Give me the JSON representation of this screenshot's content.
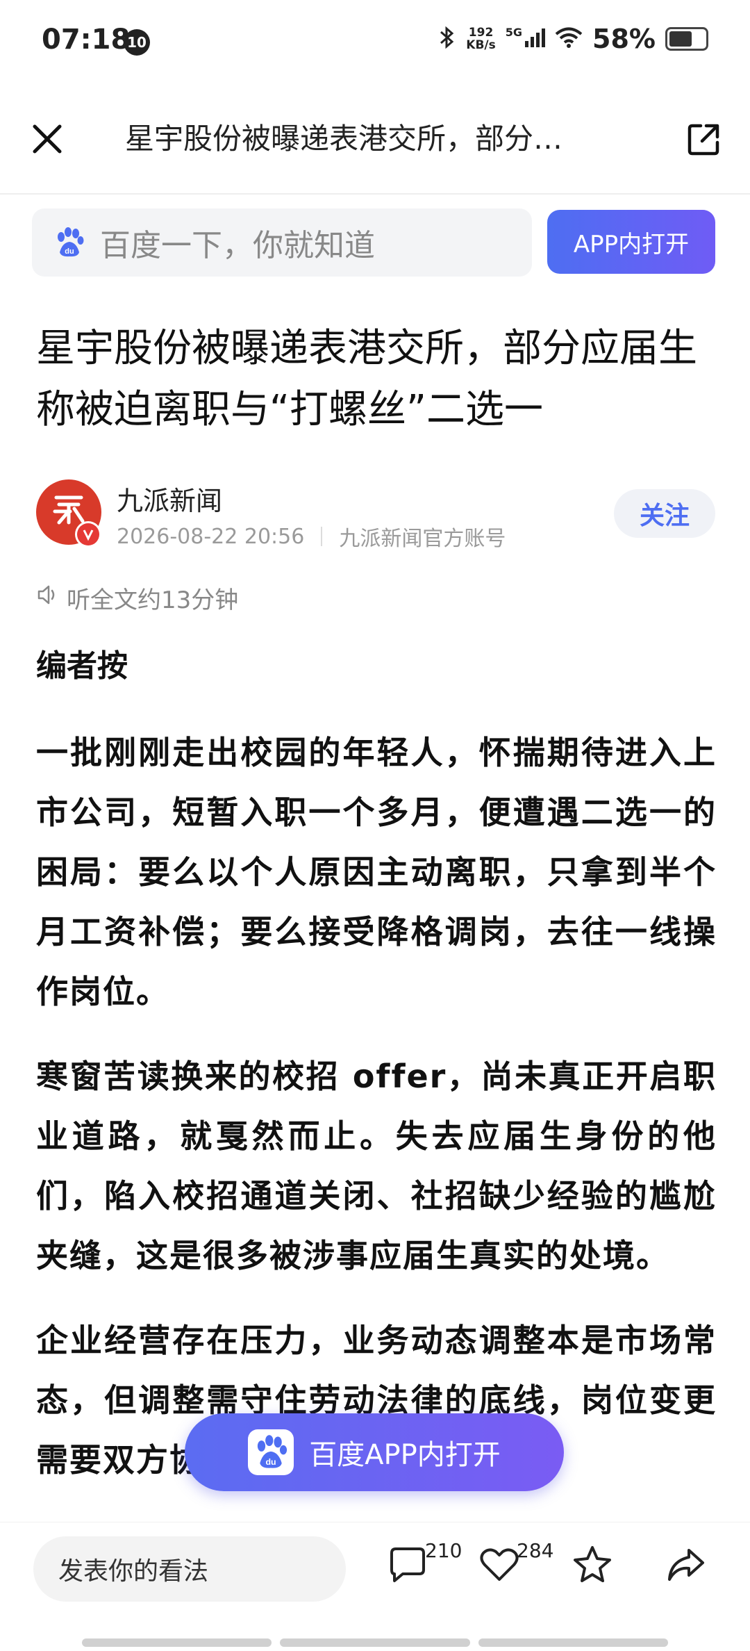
{
  "status_bar": {
    "time": "07:18",
    "notification_badge": "10",
    "net_speed_value": "192",
    "net_speed_unit": "KB/s",
    "signal_label": "5G",
    "battery_text": "58%",
    "battery_level": 0.58
  },
  "title_bar": {
    "title": "星宇股份被曝递表港交所，部分…"
  },
  "search": {
    "placeholder": "百度一下，你就知道",
    "app_button": "APP内打开"
  },
  "article": {
    "headline": "星宇股份被曝递表港交所，部分应届生称被迫离职与“打螺丝”二选一",
    "author": {
      "name": "九派新闻",
      "date": "2026-08-22 20:56",
      "account_type": "九派新闻官方账号",
      "follow_label": "关注"
    },
    "listen_label": "听全文约13分钟",
    "editor_label": "编者按",
    "paragraphs": [
      "一批刚刚走出校园的年轻人，怀揣期待进入上市公司，短暂入职一个多月，便遭遇二选一的困局：要么以个人原因主动离职，只拿到半个月工资补偿；要么接受降格调岗，去往一线操作岗位。",
      "寒窗苦读换来的校招 offer，尚未真正开启职业道路，就戛然而止。失去应届生身份的他们，陷入校招通道关闭、社招缺少经验的尴尬夹缝，这是很多被涉事应届生真实的处境。",
      "企业经营存在压力，业务动态调整本是市场常态，但调整需守住劳动法律的底线，岗位变更需要双方协商，大规模人"
    ]
  },
  "floating_button": {
    "label": "百度APP内打开"
  },
  "bottom_bar": {
    "comment_placeholder": "发表你的看法",
    "comment_count": "210",
    "like_count": "284"
  },
  "colors": {
    "accent": "#4e6ef2",
    "accent_gradient_end": "#7a5cf3",
    "avatar_red": "#d83a2a"
  }
}
